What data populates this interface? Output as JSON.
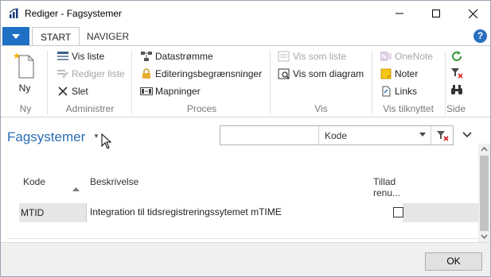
{
  "window": {
    "title": "Rediger - Fagsystemer"
  },
  "tabs": [
    {
      "label": "START",
      "active": true
    },
    {
      "label": "NAVIGER",
      "active": false
    }
  ],
  "ribbon": {
    "ny": {
      "label": "Ny",
      "group": "Ny"
    },
    "administrer": {
      "group": "Administrer",
      "items": [
        "Vis liste",
        "Rediger liste",
        "Slet"
      ]
    },
    "proces": {
      "group": "Proces",
      "items": [
        "Datastrømme",
        "Editeringsbegrænsninger",
        "Mapninger"
      ]
    },
    "vis": {
      "group": "Vis",
      "items": [
        "Vis som liste",
        "Vis som diagram"
      ]
    },
    "tilknyttet": {
      "group": "Vis tilknyttet",
      "items": [
        "OneNote",
        "Noter",
        "Links"
      ]
    },
    "side": {
      "group": "Side"
    }
  },
  "page": {
    "title": "Fagsystemer"
  },
  "filter": {
    "input_value": "",
    "field": "Kode"
  },
  "table": {
    "headers": {
      "kode": "Kode",
      "beskrivelse": "Beskrivelse",
      "tillad_line1": "Tillad",
      "tillad_line2": "renu..."
    },
    "rows": [
      {
        "kode": "MTID",
        "beskrivelse": "Integration til tidsregistreringssytemet mTIME",
        "tillad": false
      }
    ]
  },
  "footer": {
    "ok_label": "OK"
  },
  "colors": {
    "accent": "#2b6db5",
    "menu_blue": "#1f6fc5",
    "selected_row": "#e6e6e6"
  }
}
